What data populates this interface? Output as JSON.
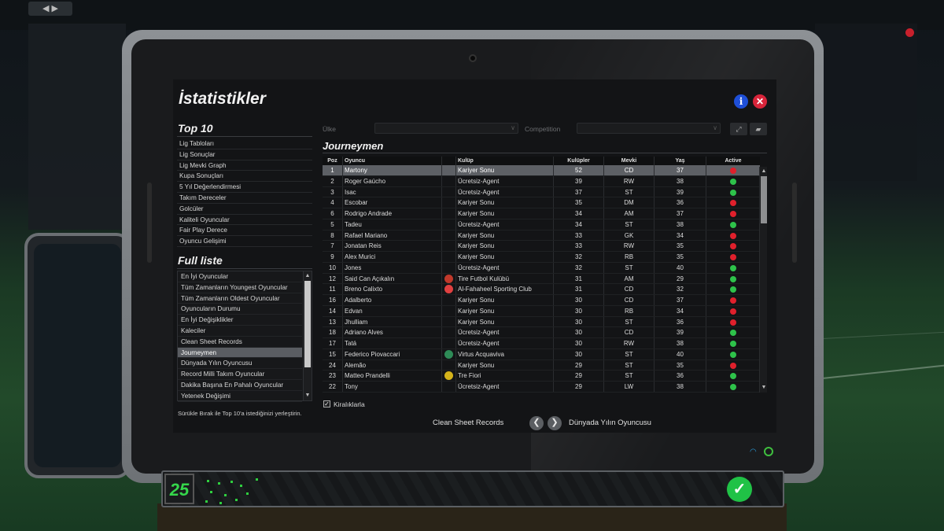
{
  "background": {
    "nav_arrows": "◀ ▶"
  },
  "screen": {
    "title": "İstatistikler",
    "info_icon": "i",
    "close_icon": "✕",
    "top10": {
      "title": "Top 10",
      "items": [
        "Lig Tabloları",
        "Lig Sonuçlar",
        "Lig Mevki Graph",
        "Kupa Sonuçları",
        "5 Yıl Değerlendirmesi",
        "Takım Dereceler",
        "Golcüler",
        "Kaliteli Oyuncular",
        "Fair Play Derece",
        "Oyuncu Gelişimi"
      ]
    },
    "full_list": {
      "title": "Full liste",
      "items": [
        "En İyi Oyuncular",
        "Tüm Zamanların Youngest Oyuncular",
        "Tüm Zamanların Oldest Oyuncular",
        "Oyuncuların Durumu",
        "En İyi Değişiklikler",
        "Kaleciler",
        "Clean Sheet Records",
        "Journeymen",
        "Dünyada Yılın Oyuncusu",
        "Record Milli Takım Oyuncular",
        "Dakika Başına En Pahalı Oyuncular",
        "Yetenek Değişimi"
      ],
      "selected_index": 7
    },
    "hint": "Sürükle Bırak ile Top 10'a istediğinizi yerleştirin.",
    "filters": {
      "country_label": "Ülke",
      "competition_label": "Competition"
    },
    "table": {
      "title": "Journeymen",
      "headers": [
        "Poz",
        "Oyuncu",
        "Kulüp",
        "Kulüpler",
        "Mevki",
        "Yaş",
        "Active"
      ],
      "rows": [
        {
          "poz": "1",
          "oyuncu": "Martony",
          "kulup": "Kariyer Sonu",
          "kulupler": "52",
          "mevki": "CD",
          "yas": "37",
          "active": false,
          "badge": ""
        },
        {
          "poz": "2",
          "oyuncu": "Roger Gaúcho",
          "kulup": "Ücretsiz-Agent",
          "kulupler": "39",
          "mevki": "RW",
          "yas": "38",
          "active": true,
          "badge": ""
        },
        {
          "poz": "3",
          "oyuncu": "Isac",
          "kulup": "Ücretsiz-Agent",
          "kulupler": "37",
          "mevki": "ST",
          "yas": "39",
          "active": true,
          "badge": ""
        },
        {
          "poz": "4",
          "oyuncu": "Escobar",
          "kulup": "Kariyer Sonu",
          "kulupler": "35",
          "mevki": "DM",
          "yas": "36",
          "active": false,
          "badge": ""
        },
        {
          "poz": "6",
          "oyuncu": "Rodrigo Andrade",
          "kulup": "Kariyer Sonu",
          "kulupler": "34",
          "mevki": "AM",
          "yas": "37",
          "active": false,
          "badge": ""
        },
        {
          "poz": "5",
          "oyuncu": "Tadeu",
          "kulup": "Ücretsiz-Agent",
          "kulupler": "34",
          "mevki": "ST",
          "yas": "38",
          "active": true,
          "badge": ""
        },
        {
          "poz": "8",
          "oyuncu": "Rafael Mariano",
          "kulup": "Kariyer Sonu",
          "kulupler": "33",
          "mevki": "GK",
          "yas": "34",
          "active": false,
          "badge": ""
        },
        {
          "poz": "7",
          "oyuncu": "Jonatan Reis",
          "kulup": "Kariyer Sonu",
          "kulupler": "33",
          "mevki": "RW",
          "yas": "35",
          "active": false,
          "badge": ""
        },
        {
          "poz": "9",
          "oyuncu": "Alex Murici",
          "kulup": "Kariyer Sonu",
          "kulupler": "32",
          "mevki": "RB",
          "yas": "35",
          "active": false,
          "badge": ""
        },
        {
          "poz": "10",
          "oyuncu": "Jones",
          "kulup": "Ücretsiz-Agent",
          "kulupler": "32",
          "mevki": "ST",
          "yas": "40",
          "active": true,
          "badge": ""
        },
        {
          "poz": "12",
          "oyuncu": "Said Can Açıkalın",
          "kulup": "Tire Futbol Kulübü",
          "kulupler": "31",
          "mevki": "AM",
          "yas": "29",
          "active": true,
          "badge": "#c0392b"
        },
        {
          "poz": "11",
          "oyuncu": "Breno Calixto",
          "kulup": "Al-Fahaheel Sporting Club",
          "kulupler": "31",
          "mevki": "CD",
          "yas": "32",
          "active": true,
          "badge": "#e04040"
        },
        {
          "poz": "16",
          "oyuncu": "Adalberto",
          "kulup": "Kariyer Sonu",
          "kulupler": "30",
          "mevki": "CD",
          "yas": "37",
          "active": false,
          "badge": ""
        },
        {
          "poz": "14",
          "oyuncu": "Edvan",
          "kulup": "Kariyer Sonu",
          "kulupler": "30",
          "mevki": "RB",
          "yas": "34",
          "active": false,
          "badge": ""
        },
        {
          "poz": "13",
          "oyuncu": "Jhulliam",
          "kulup": "Kariyer Sonu",
          "kulupler": "30",
          "mevki": "ST",
          "yas": "36",
          "active": false,
          "badge": ""
        },
        {
          "poz": "18",
          "oyuncu": "Adriano Alves",
          "kulup": "Ücretsiz-Agent",
          "kulupler": "30",
          "mevki": "CD",
          "yas": "39",
          "active": true,
          "badge": ""
        },
        {
          "poz": "17",
          "oyuncu": "Tatá",
          "kulup": "Ücretsiz-Agent",
          "kulupler": "30",
          "mevki": "RW",
          "yas": "38",
          "active": true,
          "badge": ""
        },
        {
          "poz": "15",
          "oyuncu": "Federico Piovaccari",
          "kulup": "Virtus Acquaviva",
          "kulupler": "30",
          "mevki": "ST",
          "yas": "40",
          "active": true,
          "badge": "#2e8b57"
        },
        {
          "poz": "24",
          "oyuncu": "Alemão",
          "kulup": "Kariyer Sonu",
          "kulupler": "29",
          "mevki": "ST",
          "yas": "35",
          "active": false,
          "badge": ""
        },
        {
          "poz": "23",
          "oyuncu": "Matteo Prandelli",
          "kulup": "Tre Fiori",
          "kulupler": "29",
          "mevki": "ST",
          "yas": "36",
          "active": true,
          "badge": "#d4b21a"
        },
        {
          "poz": "22",
          "oyuncu": "Tony",
          "kulup": "Ücretsiz-Agent",
          "kulupler": "29",
          "mevki": "LW",
          "yas": "38",
          "active": true,
          "badge": ""
        }
      ],
      "selected_index": 0
    },
    "loans_checkbox": {
      "label": "Kiralıklarla",
      "checked": true
    },
    "nav": {
      "prev_label": "Clean Sheet Records",
      "next_label": "Dünyada Yılın Oyuncusu",
      "prev_icon": "❮",
      "next_icon": "❯"
    }
  },
  "bottom_bar": {
    "day": "25",
    "confirm_icon": "✓"
  },
  "colors": {
    "active_green": "#2ec24a",
    "inactive_red": "#e0202c",
    "accent_green": "#35d64b",
    "info_blue": "#1e4fd8",
    "close_red": "#d8243a"
  }
}
